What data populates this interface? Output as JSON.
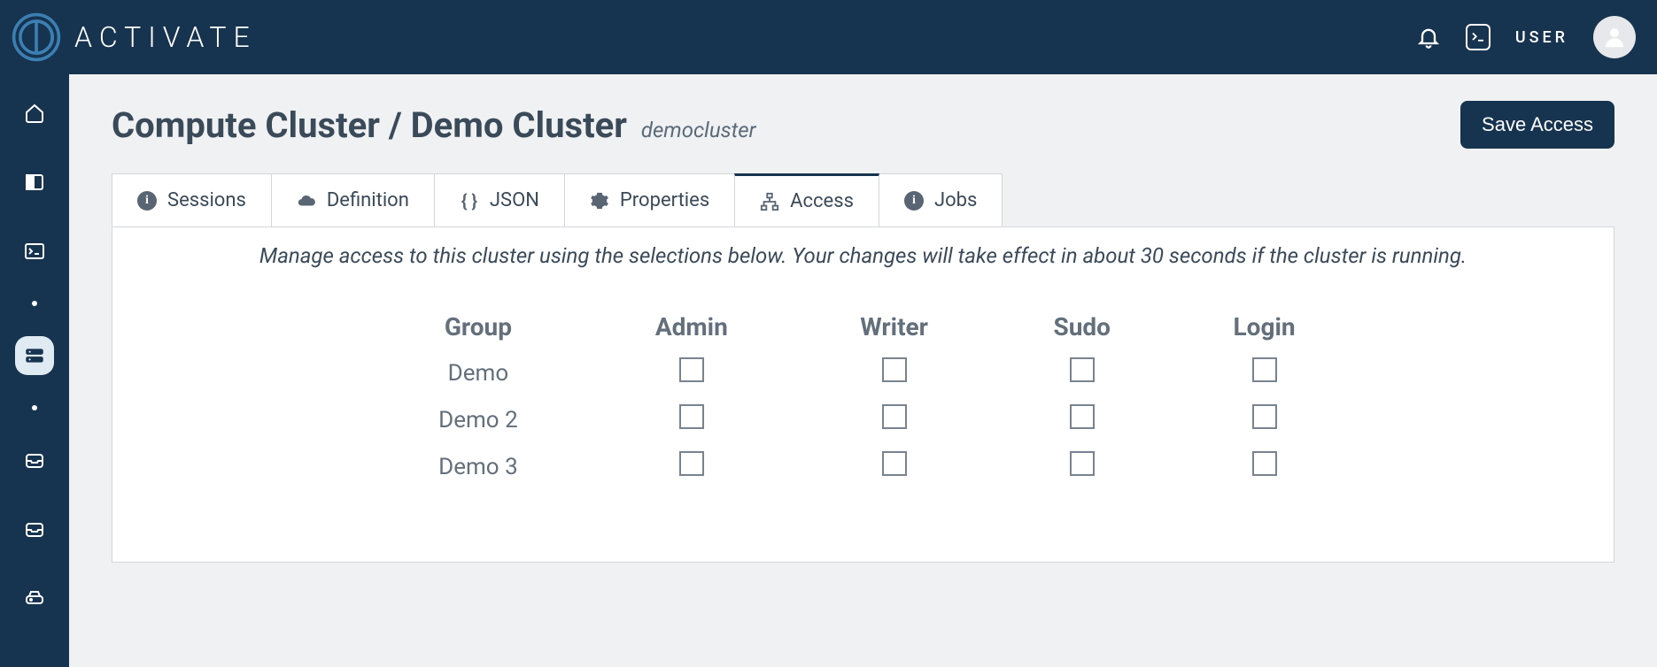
{
  "brand": {
    "name": "ACTIVATE"
  },
  "header": {
    "user_label": "USER"
  },
  "page": {
    "title_prefix": "Compute Cluster / ",
    "cluster_name": "Demo Cluster",
    "cluster_id": "democluster",
    "save_button": "Save Access"
  },
  "tabs": [
    {
      "label": "Sessions",
      "icon": "info"
    },
    {
      "label": "Definition",
      "icon": "cloud"
    },
    {
      "label": "JSON",
      "icon": "braces"
    },
    {
      "label": "Properties",
      "icon": "gear"
    },
    {
      "label": "Access",
      "icon": "network",
      "active": true
    },
    {
      "label": "Jobs",
      "icon": "info"
    }
  ],
  "access": {
    "help_text": "Manage access to this cluster using the selections below. Your changes will take effect in about 30 seconds if the cluster is running.",
    "columns": [
      "Group",
      "Admin",
      "Writer",
      "Sudo",
      "Login"
    ],
    "rows": [
      {
        "group": "Demo",
        "admin": false,
        "writer": false,
        "sudo": false,
        "login": false
      },
      {
        "group": "Demo 2",
        "admin": false,
        "writer": false,
        "sudo": false,
        "login": false
      },
      {
        "group": "Demo 3",
        "admin": false,
        "writer": false,
        "sudo": false,
        "login": false
      }
    ]
  }
}
